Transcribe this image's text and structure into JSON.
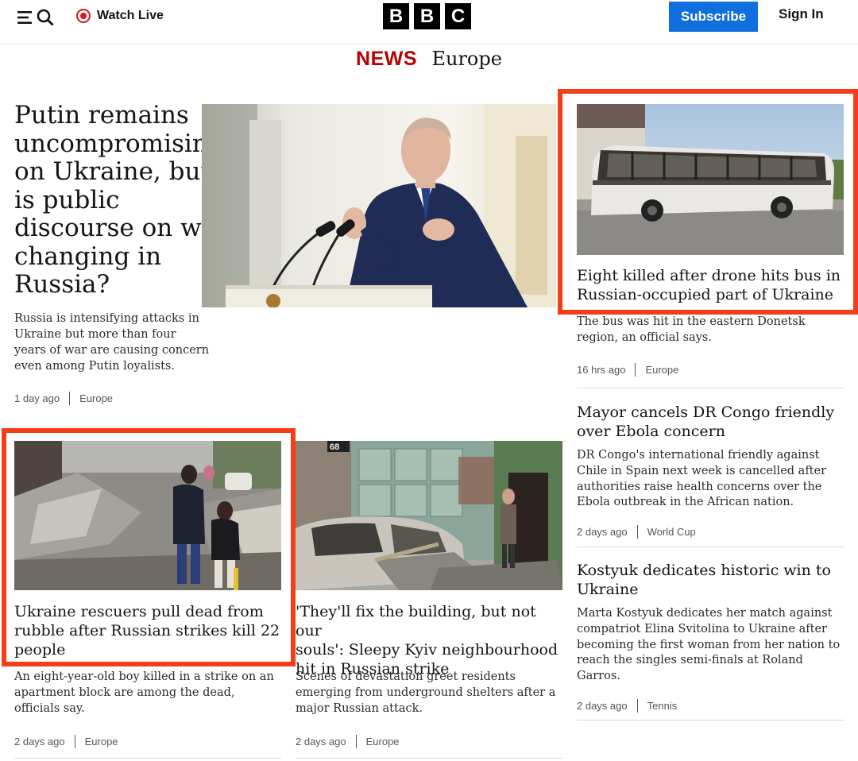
{
  "header": {
    "watch_live": "Watch Live",
    "logo_letters": [
      "B",
      "B",
      "C"
    ],
    "subscribe": "Subscribe",
    "sign_in": "Sign In"
  },
  "section": {
    "news": "NEWS",
    "region": "Europe"
  },
  "lead": {
    "title_lines": [
      "Putin remains",
      "uncompromising",
      "on Ukraine, but",
      "is public",
      "discourse on war",
      "changing in",
      "Russia?"
    ],
    "summary_lines": [
      "Russia is intensifying attacks in",
      "Ukraine but more than four",
      "years of war are causing concern",
      "even among Putin loyalists."
    ],
    "time": "1 day ago",
    "tag": "Europe"
  },
  "bus_story": {
    "title_lines": [
      "Eight killed after drone hits bus in",
      "Russian-occupied part of Ukraine"
    ],
    "summary_lines": [
      "The bus was hit in the eastern Donetsk",
      "region, an official says."
    ],
    "time": "16 hrs ago",
    "tag": "Europe"
  },
  "congo_story": {
    "title_lines": [
      "Mayor cancels DR Congo friendly",
      "over Ebola concern"
    ],
    "summary_lines": [
      "DR Congo's international friendly against",
      "Chile in Spain next week is cancelled after",
      "authorities raise health concerns over the",
      "Ebola outbreak in the African nation."
    ],
    "time": "2 days ago",
    "tag": "World Cup"
  },
  "kostyuk_story": {
    "title_lines": [
      "Kostyuk dedicates historic win to",
      "Ukraine"
    ],
    "summary_lines": [
      "Marta Kostyuk dedicates her match against",
      "compatriot Elina Svitolina to Ukraine after",
      "becoming the first woman from her nation to",
      "reach the singles semi-finals at Roland",
      "Garros."
    ],
    "time": "2 days ago",
    "tag": "Tennis"
  },
  "rescue_story": {
    "title_lines": [
      "Ukraine rescuers pull dead from",
      "rubble after Russian strikes kill 22",
      "people"
    ],
    "summary_lines": [
      "An eight-year-old boy killed in a strike on an",
      "apartment block are among the dead,",
      "officials say."
    ],
    "time": "2 days ago",
    "tag": "Europe"
  },
  "kyiv_story": {
    "title_lines": [
      "'They'll fix the building, but not our",
      "souls': Sleepy Kyiv neighbourhood",
      "hit in Russian strike"
    ],
    "summary_lines": [
      "Scenes of devastation greet residents",
      "emerging from underground shelters after a",
      "major Russian attack."
    ],
    "time": "2 days ago",
    "tag": "Europe",
    "sign_number": "68"
  },
  "colors": {
    "news_red": "#b80000",
    "subscribe_blue": "#0f6fde",
    "highlight_red": "#f53d17",
    "live_red": "#d11a1a"
  }
}
